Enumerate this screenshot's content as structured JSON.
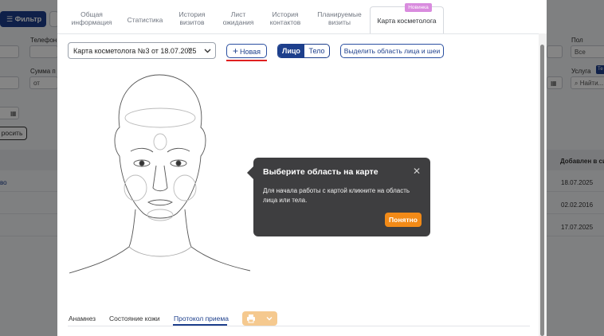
{
  "background": {
    "filter_button_label": "Фильтр",
    "phone_label": "Телефон",
    "sum_label": "Сумма п",
    "sum_from_value": "от",
    "reset_label": "росить",
    "gender_label": "Пол",
    "gender_value": "Все",
    "service_label": "Услуга",
    "service_placeholder": "Найти...",
    "added_column": "Добавлен в сис",
    "row_link_fragment": "во",
    "row_dates": [
      "18.07.2025",
      "02.02.2016",
      "17.07.2025"
    ],
    "service_badge_fragment": "Те"
  },
  "tabs": [
    {
      "label": "Общая\nинформация"
    },
    {
      "label": "Статистика"
    },
    {
      "label": "История\nвизитов"
    },
    {
      "label": "Лист\nожидания"
    },
    {
      "label": "История\nконтактов"
    },
    {
      "label": "Планируемые\nвизиты"
    },
    {
      "label": "Карта косметолога"
    }
  ],
  "new_badge": "Новинка",
  "card_select": {
    "value": "Карта косметолога №3 от 18.07.2025"
  },
  "toolbar": {
    "new_label": "Новая",
    "face_label": "Лицо",
    "body_label": "Тело",
    "select_area_label": "Выделить область лица и шеи"
  },
  "bottom_tabs": [
    {
      "label": "Анамнез"
    },
    {
      "label": "Состояние кожи"
    },
    {
      "label": "Протокол приема"
    }
  ],
  "popup": {
    "title": "Выберите область на карте",
    "text": "Для начала работы с картой кликните на область лица или тела.",
    "button_label": "Понятно"
  },
  "colors": {
    "accent": "#1d3f8c",
    "popup_bg": "#3e3e40",
    "popup_button": "#f28a17",
    "badge": "#d98bde",
    "underline_red": "#e02020"
  }
}
